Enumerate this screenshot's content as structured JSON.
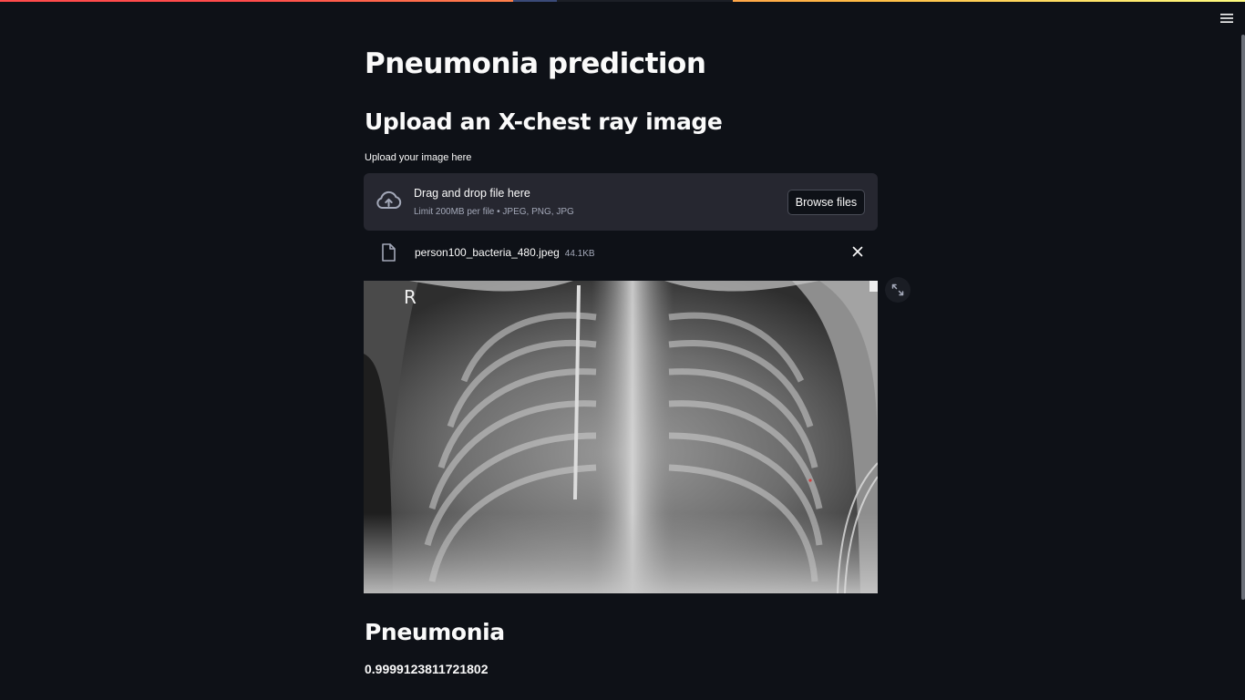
{
  "app": {
    "menu_icon": "hamburger-menu-icon"
  },
  "main": {
    "title": "Pneumonia prediction",
    "subtitle": "Upload an X-chest ray image",
    "uploader": {
      "label": "Upload your image here",
      "dropzone_title": "Drag and drop file here",
      "dropzone_hint": "Limit 200MB per file • JPEG, PNG, JPG",
      "browse_label": "Browse files",
      "upload_icon": "cloud-upload-icon"
    },
    "uploaded_file": {
      "name": "person100_bacteria_480.jpeg",
      "size": "44.1KB",
      "file_icon": "file-icon",
      "remove_icon": "close-icon"
    },
    "image": {
      "marker_text": "R",
      "expand_icon": "fullscreen-expand-icon"
    },
    "result": {
      "label": "Pneumonia",
      "score": "0.9999123811721802"
    }
  },
  "colors": {
    "background": "#0e1117",
    "surface": "#262730",
    "text": "#fafafa",
    "muted_text": "#a3a8b8",
    "accent": "#ff4b4b"
  }
}
